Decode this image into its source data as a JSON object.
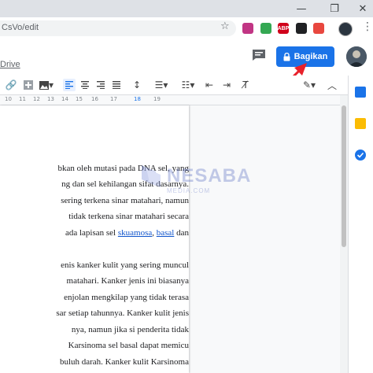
{
  "browser": {
    "url_fragment": "CsVo/edit",
    "extensions": [
      {
        "icon": "instagram-icon",
        "label": "",
        "color": "#c13584"
      },
      {
        "icon": "drive-icon",
        "label": "",
        "color": "#34a853"
      },
      {
        "icon": "abp-icon",
        "label": "ABP",
        "color": "#d0021b"
      },
      {
        "icon": "incognito-icon",
        "label": "",
        "color": "#202124"
      },
      {
        "icon": "clipper-icon",
        "label": "",
        "color": "#e8473f"
      }
    ]
  },
  "doc_header": {
    "drive_link": "Drive",
    "share_label": "Bagikan"
  },
  "ruler": {
    "ticks": [
      "10",
      "11",
      "12",
      "13",
      "14",
      "15",
      "16",
      "17",
      "18",
      "19"
    ]
  },
  "document": {
    "paragraph1": [
      "bkan oleh mutasi pada DNA sel, yang",
      "ng dan sel kehilangan sifat dasarnya.",
      "sering terkena sinar matahari, namun",
      "tidak terkena sinar matahari secara"
    ],
    "p1_last_prefix": "ada lapisan sel ",
    "p1_link1": "skuamosa",
    "p1_sep": ", ",
    "p1_link2": "basal",
    "p1_suffix": " dan",
    "paragraph2": [
      "enis kanker kulit yang sering muncul",
      "matahari.  Kanker jenis ini biasanya",
      "enjolan mengkilap yang tidak terasa",
      "sar setiap tahunnya. Kanker kulit jenis",
      "nya,  namun  jika  si  penderita  tidak",
      "Karsinoma  sel  basal  dapat  memicu",
      "buluh darah. Kanker kulit Karsinoma"
    ]
  },
  "watermark": {
    "brand": "NESABA",
    "sub": "MEDIA.COM"
  },
  "colors": {
    "accent": "#1a73e8",
    "arrow": "#e8212b"
  }
}
